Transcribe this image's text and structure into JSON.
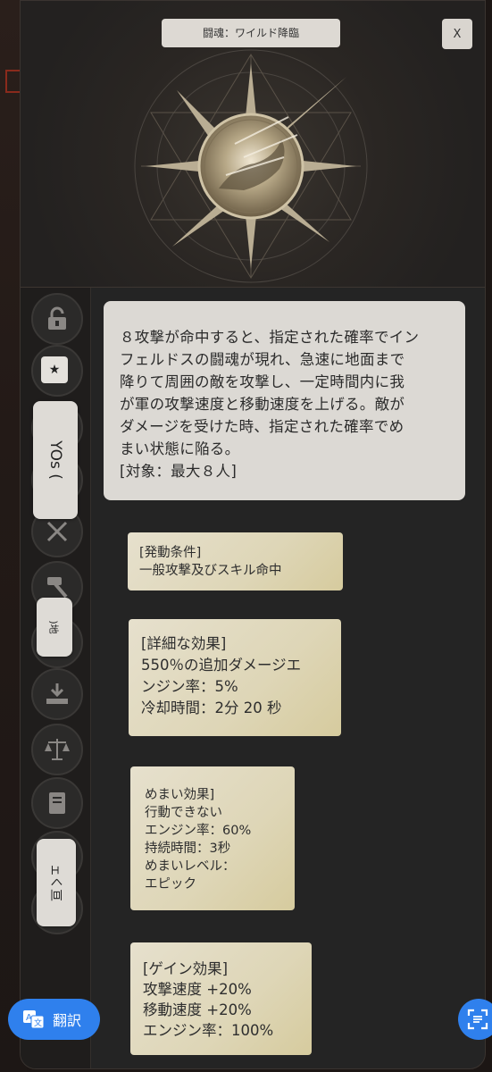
{
  "header": {
    "title": "闘魂：ワイルド降臨",
    "close_label": "X"
  },
  "side": {
    "tab1_text": "YOs (",
    "tab2_text": ")地",
    "tab3_text": "ェく亘"
  },
  "description": {
    "lines": [
      "８攻撃が命中すると、指定された確率でイン",
      "フェルドスの闘魂が現れ、急速に地面まで",
      "降りて周囲の敵を攻撃し、一定時間内に我",
      "が軍の攻撃速度と移動速度を上げる。敵が",
      "ダメージを受けた時、指定された確率でめ",
      "まい状態に陥る。",
      "[対象：最大８人]"
    ]
  },
  "cards": {
    "trigger": {
      "lines": [
        "[発動条件]",
        "一般攻撃及びスキル命中"
      ]
    },
    "detail": {
      "lines": [
        "[詳細な効果]",
        "550％の追加ダメージエ",
        "ンジン率：5%",
        "冷却時間：2分 20 秒"
      ]
    },
    "stun": {
      "lines": [
        "めまい効果]",
        "行動できない",
        "エンジン率：60%",
        "持続時間：3秒",
        "めまいレベル：",
        "エピック"
      ]
    },
    "gain": {
      "lines": [
        "[ゲイン効果]",
        "攻撃速度 +20%",
        "移動速度 +20%",
        "エンジン率：100%"
      ]
    }
  },
  "translate": {
    "label": "翻訳"
  },
  "colors": {
    "accent_blue": "#2f80ed",
    "panel": "#242424",
    "card": "#ded6b7"
  }
}
